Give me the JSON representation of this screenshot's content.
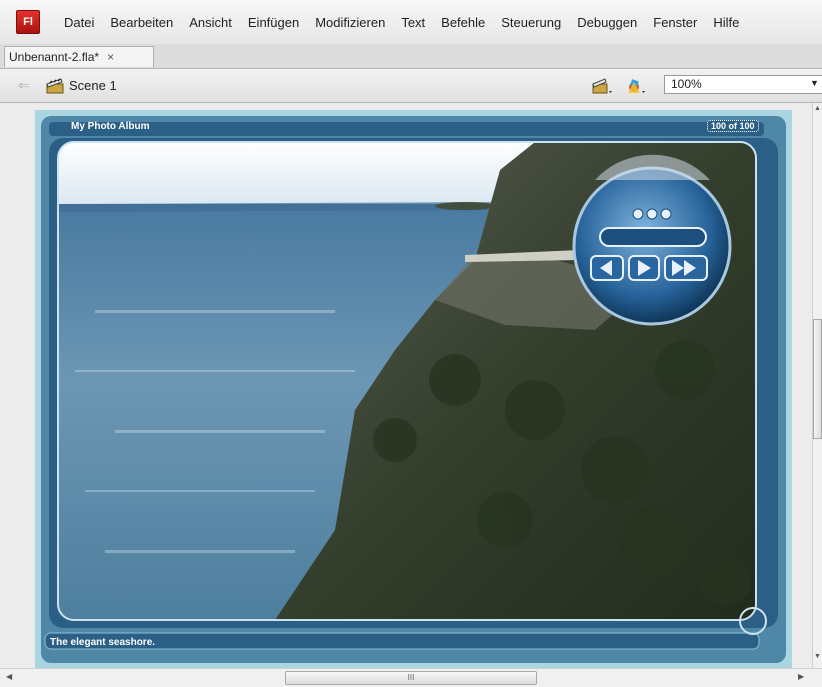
{
  "app": {
    "logo_text": "Fl"
  },
  "menu": [
    "Datei",
    "Bearbeiten",
    "Ansicht",
    "Einfügen",
    "Modifizieren",
    "Text",
    "Befehle",
    "Steuerung",
    "Debuggen",
    "Fenster",
    "Hilfe"
  ],
  "document_tab": {
    "title": "Unbenannt-2.fla*",
    "close_glyph": "×"
  },
  "editbar": {
    "back_icon": "back-arrow-icon",
    "scene_label": "Scene 1",
    "zoom_value": "100%"
  },
  "stage": {
    "album_title": "My Photo Album",
    "counter": "100 of 100",
    "caption": "The elegant seashore."
  },
  "scrollbar": {
    "h_grip": "III"
  },
  "colors": {
    "stage_border": "#a9d6e0",
    "album_bar": "#2c5f86",
    "app_logo": "#c41a16",
    "sea": "#6c97b4",
    "cliff": "#343e2c"
  }
}
